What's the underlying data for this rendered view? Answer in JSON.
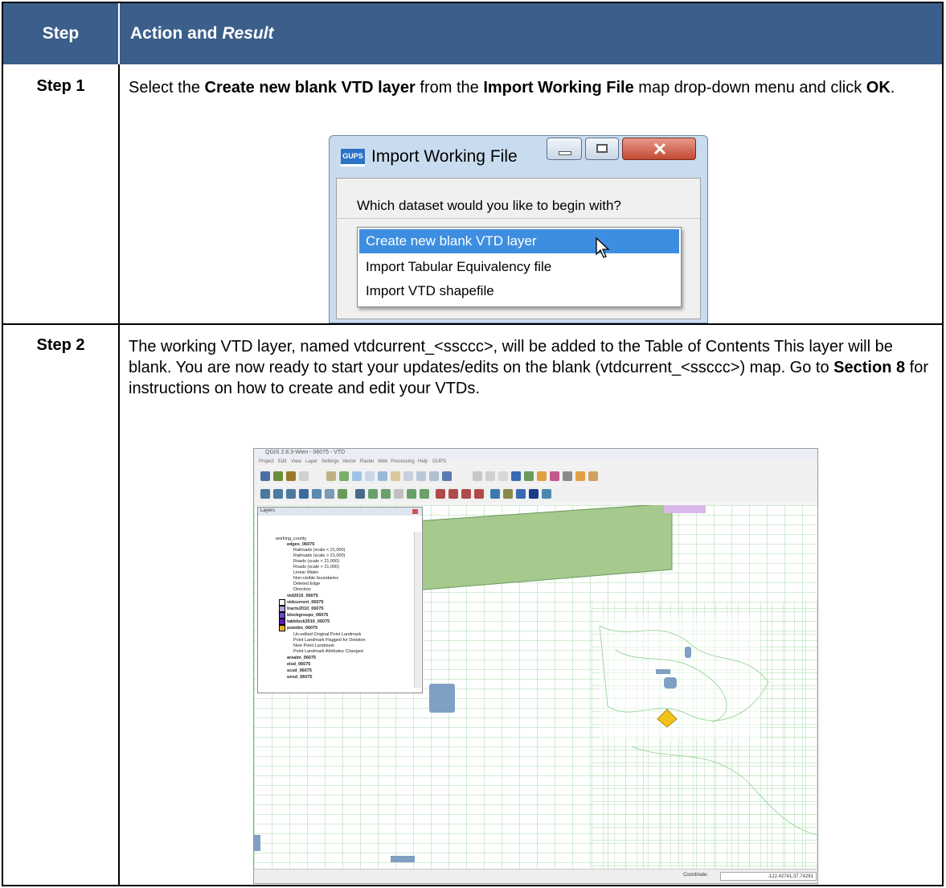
{
  "table": {
    "header": {
      "step": "Step",
      "action_prefix": "Action and ",
      "action_italic": "Result"
    },
    "rows": [
      {
        "step": "Step 1",
        "text": {
          "t1": "Select the ",
          "b1": "Create new blank VTD layer",
          "t2": " from the ",
          "b2": "Import Working File",
          "t3": " map drop-down menu and click ",
          "b3": "OK",
          "t4": "."
        }
      },
      {
        "step": "Step 2",
        "text": {
          "t1": "The working VTD layer, named vtdcurrent_<ssccc>, will be added to the Table of Contents This layer will be blank. You are now ready to start your updates/edits on the blank (vtdcurrent_<ssccc>) map. Go to ",
          "b1": "Section 8",
          "t2": " for instructions on how to create and edit your VTDs."
        }
      }
    ]
  },
  "dialog": {
    "logo": "GUPS",
    "title": "Import Working File",
    "question": "Which dataset would you like to begin with?",
    "options": [
      {
        "label": "Create new blank VTD layer",
        "selected": true
      },
      {
        "label": "Import Tabular Equivalency file",
        "selected": false
      },
      {
        "label": "Import VTD shapefile",
        "selected": false
      }
    ]
  },
  "qgis": {
    "title": "QGIS 2.8.3-Wien - 06075 - VTD",
    "menu": [
      "Project",
      "Edit",
      "View",
      "Layer",
      "Settings",
      "Vector",
      "Raster",
      "Web",
      "Processing",
      "Help",
      "GUPS"
    ],
    "layers_panel_title": "Layers",
    "layers": [
      {
        "label": "working_county",
        "bold": false
      },
      {
        "label": "edges_06075",
        "bold": true
      },
      {
        "label": "Railroads (scale < 21,000)",
        "bold": false
      },
      {
        "label": "Railroads (scale > 21,000)",
        "bold": false
      },
      {
        "label": "Roads (scale < 21,000)",
        "bold": false
      },
      {
        "label": "Roads (scale > 21,000)",
        "bold": false
      },
      {
        "label": "Linear Water",
        "bold": false
      },
      {
        "label": "Non-visible boundaries",
        "bold": false
      },
      {
        "label": "Deleted Edge",
        "bold": false
      },
      {
        "label": "Direction",
        "bold": false
      },
      {
        "label": "vtd2010_06075",
        "bold": true
      },
      {
        "label": "vtdcurrent_06075",
        "bold": true
      },
      {
        "label": "tracts2010_06075",
        "bold": true
      },
      {
        "label": "blockgroups_06075",
        "bold": true
      },
      {
        "label": "tabblock2010_06075",
        "bold": true
      },
      {
        "label": "pointlm_06075",
        "bold": true
      },
      {
        "label": "Un-edited Original Point Landmark",
        "bold": false
      },
      {
        "label": "Point Landmark Flagged for Deletion",
        "bold": false
      },
      {
        "label": "New Point Landmark",
        "bold": false
      },
      {
        "label": "Point Landmark Attributes Changed",
        "bold": false
      },
      {
        "label": "arealm_06075",
        "bold": true
      },
      {
        "label": "elsd_06075",
        "bold": true
      },
      {
        "label": "scsd_06075",
        "bold": true
      },
      {
        "label": "unsd_06075",
        "bold": true
      }
    ],
    "coordinate_label": "Coordinate:",
    "coordinate_value": "-122.42741,37.74281",
    "colors": {
      "park": "#a6c98d",
      "roads": "#7fc47f",
      "water": "#7f9fc4",
      "landmark": "#f2c21a",
      "header": "#3b5f8a"
    }
  }
}
